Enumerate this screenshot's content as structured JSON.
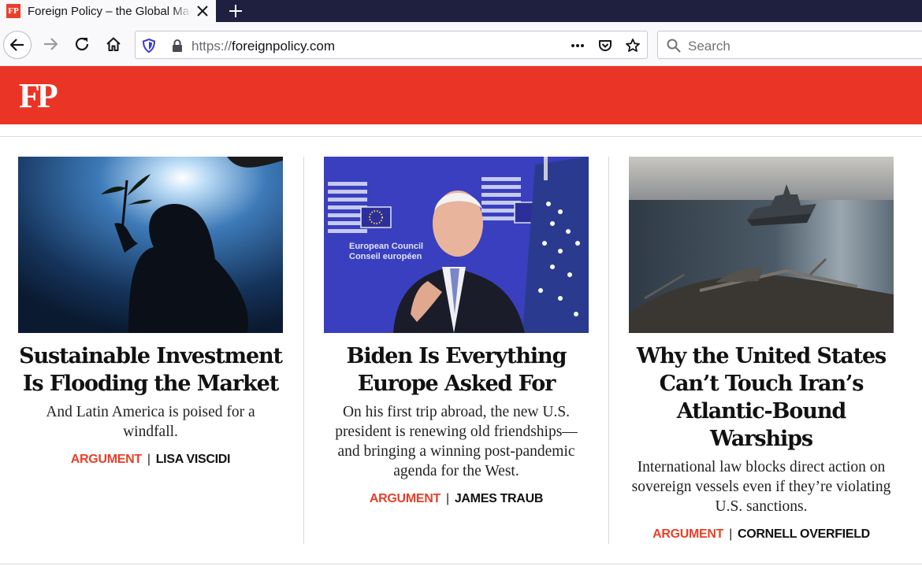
{
  "browser": {
    "tab_title": "Foreign Policy – the Global Magazine of News and Ideas",
    "favicon_text": "FP",
    "url_scheme": "https://",
    "url_host": "foreignpolicy.com",
    "search_placeholder": "Search",
    "icons": [
      "back-arrow-icon",
      "forward-arrow-icon",
      "reload-icon",
      "home-icon",
      "shield-icon",
      "lock-icon",
      "more-icon",
      "pocket-icon",
      "star-icon",
      "search-icon",
      "close-icon",
      "plus-icon"
    ]
  },
  "site": {
    "logo": "FP",
    "brand_color": "#ea3425"
  },
  "articles": [
    {
      "headline": "Sustainable Investment Is Flooding the Market",
      "dek": "And Latin America is poised for a windfall.",
      "type": "ARGUMENT",
      "author": "LISA VISCIDI"
    },
    {
      "headline": "Biden Is Everything Europe Asked For",
      "dek": "On his first trip abroad, the new U.S. president is renewing old friendships—and bringing a winning post-pandemic agenda for the West.",
      "type": "ARGUMENT",
      "author": "JAMES TRAUB",
      "image_text": [
        "European Council",
        "Conseil européen"
      ]
    },
    {
      "headline": "Why the United States Can’t Touch Iran’s Atlantic-Bound Warships",
      "dek": "International law blocks direct action on sovereign vessels even if they’re violating U.S. sanctions.",
      "type": "ARGUMENT",
      "author": "CORNELL OVERFIELD"
    }
  ]
}
